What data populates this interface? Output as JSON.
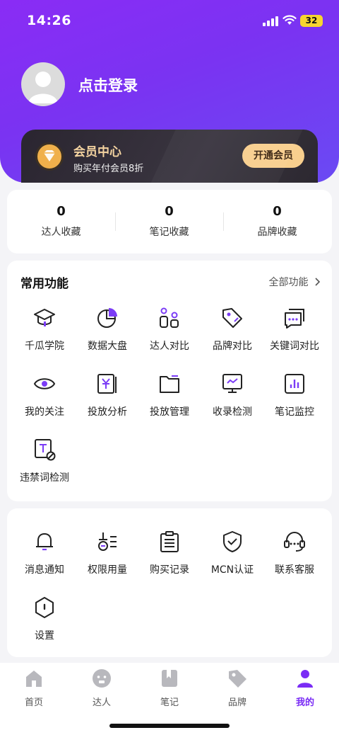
{
  "status_bar": {
    "time": "14:26",
    "battery": "32"
  },
  "profile": {
    "login_text": "点击登录"
  },
  "vip": {
    "title": "会员中心",
    "subtitle": "购买年付会员8折",
    "button": "开通会员",
    "accent": "#f8cf8e"
  },
  "stats": [
    {
      "value": "0",
      "label": "达人收藏"
    },
    {
      "value": "0",
      "label": "笔记收藏"
    },
    {
      "value": "0",
      "label": "品牌收藏"
    }
  ],
  "functions": {
    "title": "常用功能",
    "all_link": "全部功能",
    "items": [
      {
        "label": "千瓜学院",
        "icon": "graduation-cap-icon"
      },
      {
        "label": "数据大盘",
        "icon": "pie-chart-icon"
      },
      {
        "label": "达人对比",
        "icon": "compare-people-icon"
      },
      {
        "label": "品牌对比",
        "icon": "tag-icon"
      },
      {
        "label": "关键词对比",
        "icon": "chat-bubble-icon"
      },
      {
        "label": "我的关注",
        "icon": "eye-icon"
      },
      {
        "label": "投放分析",
        "icon": "yuan-doc-icon"
      },
      {
        "label": "投放管理",
        "icon": "folder-icon"
      },
      {
        "label": "收录检测",
        "icon": "monitor-icon"
      },
      {
        "label": "笔记监控",
        "icon": "bar-chart-icon"
      },
      {
        "label": "违禁词检测",
        "icon": "forbidden-text-icon"
      }
    ]
  },
  "tools": {
    "items": [
      {
        "label": "消息通知",
        "icon": "bell-icon"
      },
      {
        "label": "权限用量",
        "icon": "permission-icon"
      },
      {
        "label": "购买记录",
        "icon": "clipboard-icon"
      },
      {
        "label": "MCN认证",
        "icon": "shield-check-icon"
      },
      {
        "label": "联系客服",
        "icon": "headset-icon"
      },
      {
        "label": "设置",
        "icon": "settings-hexagon-icon"
      }
    ]
  },
  "nav": [
    {
      "label": "首页",
      "icon": "home-icon"
    },
    {
      "label": "达人",
      "icon": "face-icon"
    },
    {
      "label": "笔记",
      "icon": "bookmark-icon"
    },
    {
      "label": "品牌",
      "icon": "brand-tag-icon"
    },
    {
      "label": "我的",
      "icon": "user-icon",
      "active": true
    }
  ],
  "colors": {
    "primary": "#7a2cf5",
    "accent_purple": "#7b3cf6"
  }
}
